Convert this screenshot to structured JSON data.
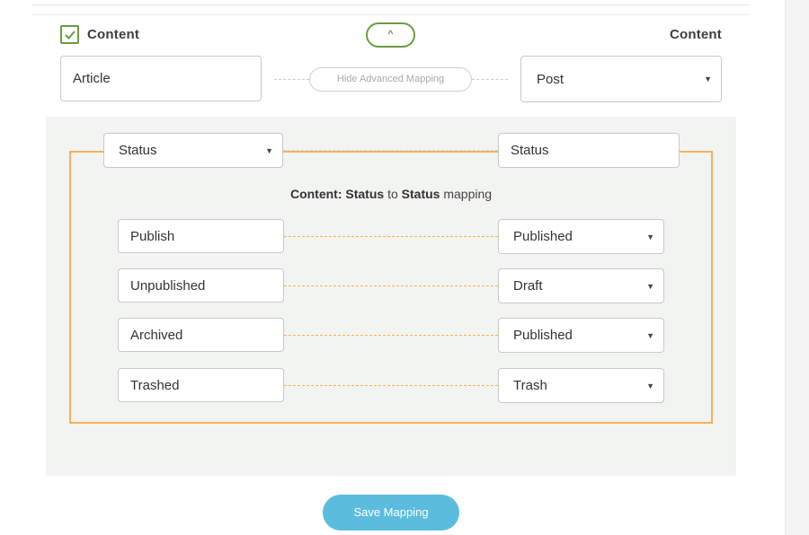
{
  "header": {
    "checkbox_checked": true,
    "left_title": "Content",
    "right_title": "Content",
    "collapse_icon": "^",
    "check_color": "#6a9d3e"
  },
  "top_mapping": {
    "source_type": "Article",
    "target_type": "Post",
    "advanced_toggle_label": "Hide Advanced Mapping"
  },
  "advanced": {
    "source_field": "Status",
    "target_field": "Status",
    "title_prefix": "Content: ",
    "title_source": "Status",
    "title_to": " to ",
    "title_target": "Status",
    "title_suffix": " mapping",
    "accent_color": "#f6b05c",
    "rows": [
      {
        "source": "Publish",
        "target": "Published"
      },
      {
        "source": "Unpublished",
        "target": "Draft"
      },
      {
        "source": "Archived",
        "target": "Published"
      },
      {
        "source": "Trashed",
        "target": "Trash"
      }
    ]
  },
  "actions": {
    "save_label": "Save Mapping",
    "save_color": "#5bbcdd"
  },
  "icons": {
    "checkmark": "check-icon",
    "caret": "▼",
    "chevron_up": "chevron-up-icon"
  }
}
